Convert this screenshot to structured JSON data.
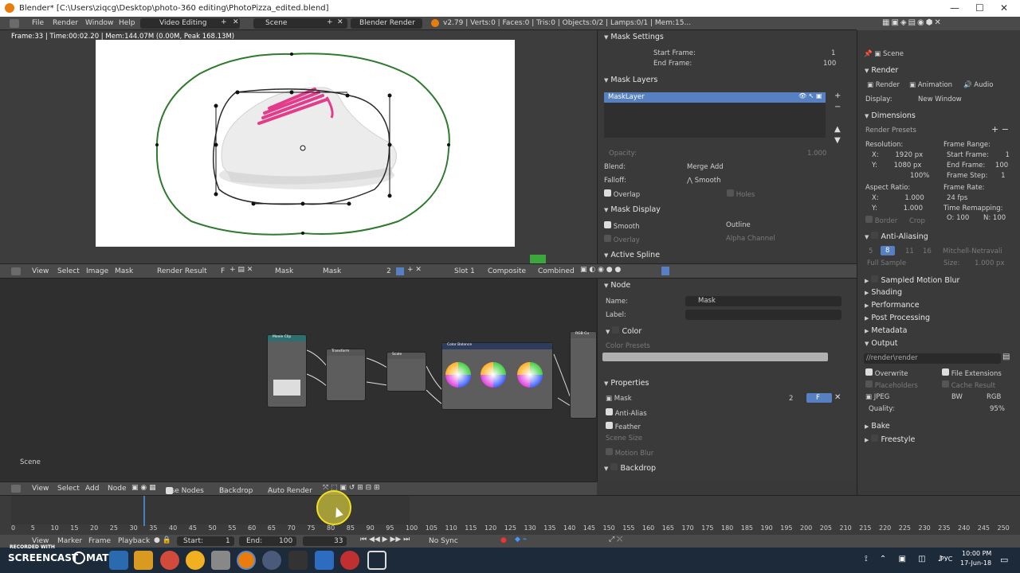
{
  "window": {
    "title": "Blender* [C:\\Users\\ziqcg\\Desktop\\photo-360 editing\\PhotoPizza_edited.blend]",
    "minimize": "—",
    "maximize": "☐",
    "close": "✕"
  },
  "topbar": {
    "menus": [
      "File",
      "Render",
      "Window",
      "Help"
    ],
    "layout": "Video Editing",
    "scene": "Scene",
    "engine": "Blender Render",
    "stats": "v2.79 | Verts:0 | Faces:0 | Tris:0 | Objects:0/2 | Lamps:0/1 | Mem:15..."
  },
  "image_editor": {
    "frame_info": "Frame:33 | Time:00:02.20 | Mem:144.07M (0.00M, Peak 168.13M)"
  },
  "mask_panel": {
    "mask_settings": "Mask Settings",
    "start_frame_label": "Start Frame:",
    "start_frame": "1",
    "end_frame_label": "End Frame:",
    "end_frame": "100",
    "mask_layers": "Mask Layers",
    "layer_name": "MaskLayer",
    "opacity_label": "Opacity:",
    "opacity": "1.000",
    "blend_label": "Blend:",
    "blend": "Merge Add",
    "falloff_label": "Falloff:",
    "falloff": "Smooth",
    "overlap": "Overlap",
    "holes": "Holes",
    "mask_display": "Mask Display",
    "smooth": "Smooth",
    "outline": "Outline",
    "overlay": "Overlay",
    "alpha_channel": "Alpha Channel",
    "active_spline": "Active Spline"
  },
  "midbar": {
    "menus": [
      "View",
      "Select",
      "Image",
      "Mask"
    ],
    "render_result": "Render Result",
    "f": "F",
    "mask1": "Mask",
    "mask2": "Mask",
    "users": "2",
    "slot": "Slot 1",
    "composite": "Composite",
    "combined": "Combined"
  },
  "node_editor": {
    "scene_label": "Scene",
    "nodes": {
      "movie_clip": "Movie Clip",
      "transform": "Transform",
      "scale": "Scale",
      "color_balance": "Color Balance",
      "rgb_curves": "RGB Cu"
    }
  },
  "node_props": {
    "node": "Node",
    "name_label": "Name:",
    "name": "Mask",
    "label_label": "Label:",
    "color": "Color",
    "color_presets": "Color Presets",
    "properties": "Properties",
    "mask": "Mask",
    "users": "2",
    "f": "F",
    "anti_alias": "Anti-Alias",
    "feather": "Feather",
    "scene_size": "Scene Size",
    "motion_blur": "Motion Blur",
    "backdrop": "Backdrop"
  },
  "nodebar": {
    "menus": [
      "View",
      "Select",
      "Add",
      "Node"
    ],
    "use_nodes": "Use Nodes",
    "backdrop": "Backdrop",
    "auto_render": "Auto Render"
  },
  "properties": {
    "scene": "Scene",
    "render": "Render",
    "render_btn": "Render",
    "animation_btn": "Animation",
    "audio_btn": "Audio",
    "display_label": "Display:",
    "display": "New Window",
    "dimensions": "Dimensions",
    "render_presets": "Render Presets",
    "resolution": "Resolution:",
    "res_x": "1920 px",
    "res_y": "1080 px",
    "res_pct": "100%",
    "frame_range": "Frame Range:",
    "start_frame": "Start Frame:",
    "start_val": "1",
    "end_frame": "End Frame:",
    "end_val": "100",
    "frame_step": "Frame Step:",
    "step_val": "1",
    "aspect_ratio": "Aspect Ratio:",
    "asp_x": "1.000",
    "asp_y": "1.000",
    "frame_rate": "Frame Rate:",
    "fps": "24 fps",
    "time_remapping": "Time Remapping:",
    "old": "O: 100",
    "new": "N: 100",
    "border": "Border",
    "crop": "Crop",
    "anti_aliasing": "Anti-Aliasing",
    "aa_samples": [
      "5",
      "8",
      "11",
      "16"
    ],
    "filter": "Mitchell-Netravali",
    "full_sample": "Full Sample",
    "size_label": "Size:",
    "size": "1.000 px",
    "sampled_motion_blur": "Sampled Motion Blur",
    "shading": "Shading",
    "performance": "Performance",
    "post_processing": "Post Processing",
    "metadata": "Metadata",
    "output": "Output",
    "output_path": "//render\\render",
    "overwrite": "Overwrite",
    "file_extensions": "File Extensions",
    "placeholders": "Placeholders",
    "cache_result": "Cache Result",
    "format": "JPEG",
    "bw": "BW",
    "rgb": "RGB",
    "quality_label": "Quality:",
    "quality": "95%",
    "bake": "Bake",
    "freestyle": "Freestyle"
  },
  "timeline": {
    "ticks": [
      "0",
      "5",
      "10",
      "15",
      "20",
      "25",
      "30",
      "35",
      "40",
      "45",
      "50",
      "55",
      "60",
      "65",
      "70",
      "75",
      "80",
      "85",
      "90",
      "95",
      "100",
      "105",
      "110",
      "115",
      "120",
      "125",
      "130",
      "135",
      "140",
      "145",
      "150",
      "155",
      "160",
      "165",
      "170",
      "175",
      "180",
      "185",
      "190",
      "195",
      "200",
      "205",
      "210",
      "215",
      "220",
      "225",
      "230",
      "235",
      "240",
      "245",
      "250"
    ],
    "current_frame": 33
  },
  "timebar": {
    "menus": [
      "View",
      "Marker",
      "Frame",
      "Playback"
    ],
    "start_label": "Start:",
    "start": "1",
    "end_label": "End:",
    "end": "100",
    "current": "33",
    "sync": "No Sync"
  },
  "taskbar": {
    "watermark_top": "RECORDED WITH",
    "watermark": "SCREENCAST",
    "watermark2": "MATIC",
    "lang": "РУС",
    "time": "10:00 PM",
    "date": "17-Jun-18"
  },
  "colors": {
    "accent": "#5680c2",
    "mask_curve": "#2e7a2e",
    "playhead": "#4a7fbf",
    "taskbar": "#1c2a3a"
  }
}
